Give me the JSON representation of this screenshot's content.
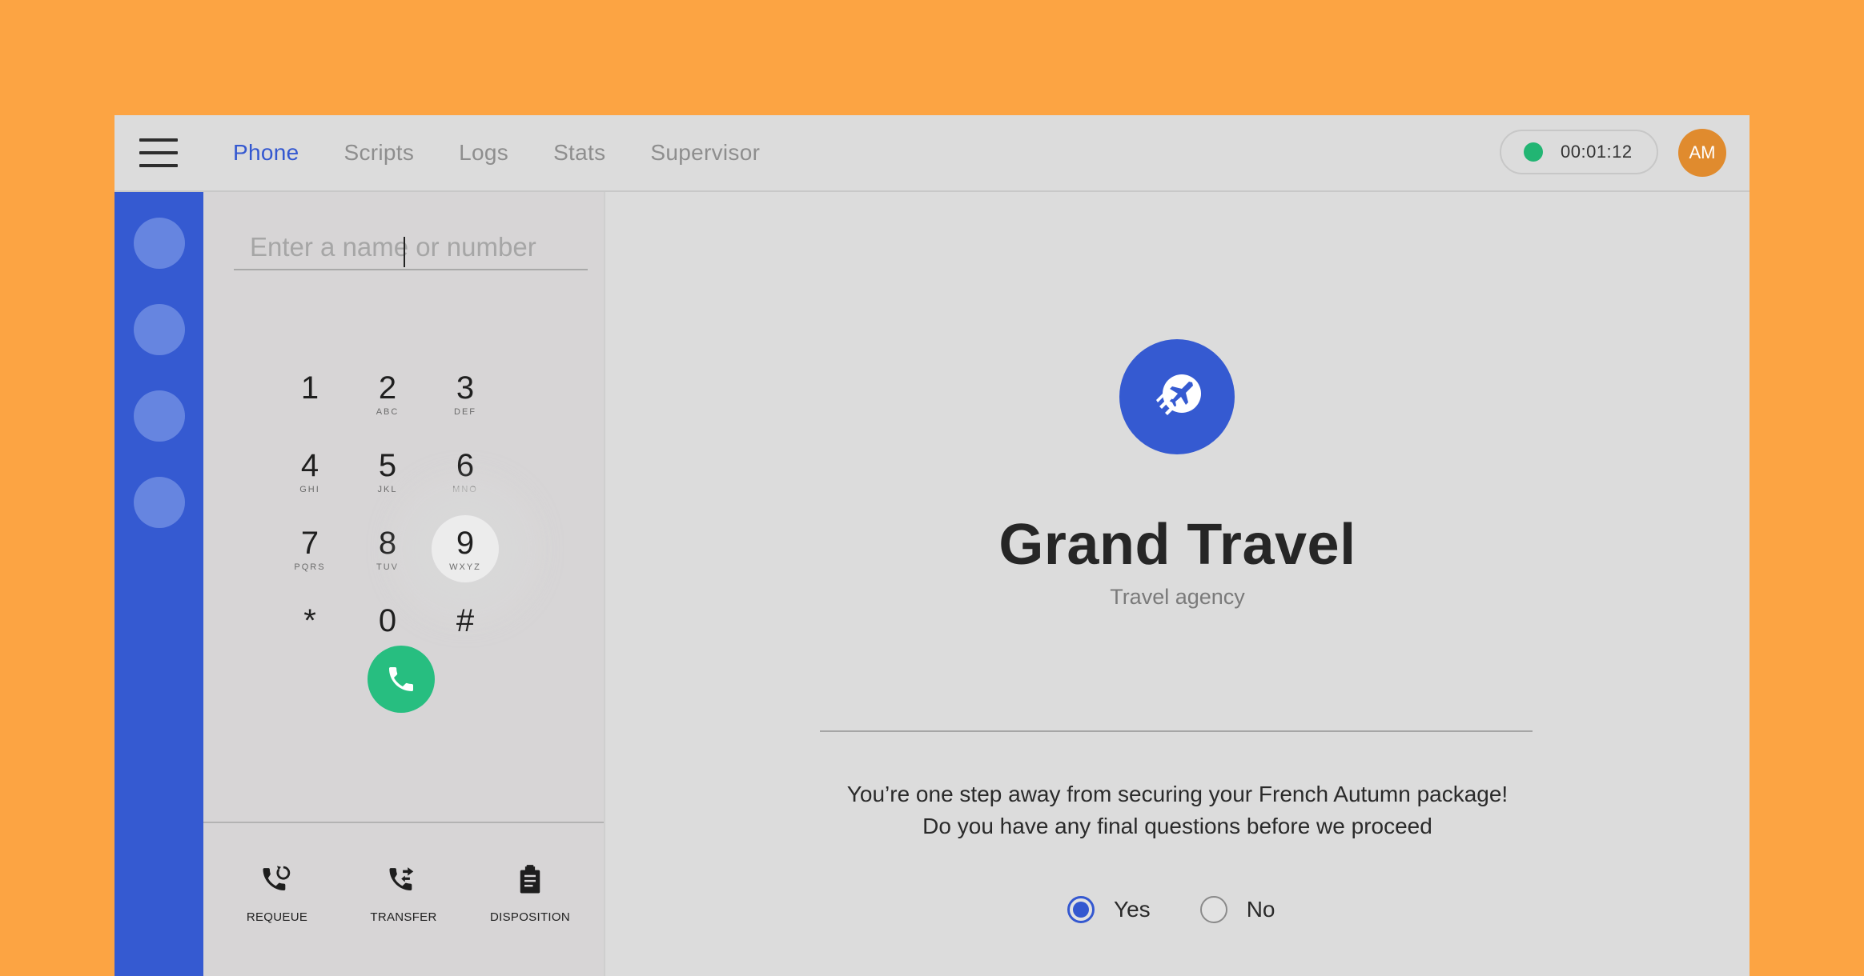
{
  "header": {
    "tabs": [
      {
        "label": "Phone",
        "active": true
      },
      {
        "label": "Scripts",
        "active": false
      },
      {
        "label": "Logs",
        "active": false
      },
      {
        "label": "Stats",
        "active": false
      },
      {
        "label": "Supervisor",
        "active": false
      }
    ],
    "timer": "00:01:12",
    "status_color": "#22B573",
    "avatar_initials": "AM"
  },
  "dialer": {
    "search_placeholder": "Enter a name or number",
    "keys": [
      {
        "num": "1",
        "letters": ""
      },
      {
        "num": "2",
        "letters": "ABC"
      },
      {
        "num": "3",
        "letters": "DEF"
      },
      {
        "num": "4",
        "letters": "GHI"
      },
      {
        "num": "5",
        "letters": "JKL"
      },
      {
        "num": "6",
        "letters": "MNO"
      },
      {
        "num": "7",
        "letters": "PQRS"
      },
      {
        "num": "8",
        "letters": "TUV"
      },
      {
        "num": "9",
        "letters": "WXYZ"
      },
      {
        "num": "*",
        "letters": ""
      },
      {
        "num": "0",
        "letters": ""
      },
      {
        "num": "#",
        "letters": ""
      }
    ],
    "pressed_key": "9",
    "call_icon": "phone-icon",
    "actions": [
      {
        "label": "REQUEUE",
        "icon": "requeue-icon"
      },
      {
        "label": "TRANSFER",
        "icon": "transfer-icon"
      },
      {
        "label": "DISPOSITION",
        "icon": "clipboard-icon"
      }
    ]
  },
  "main": {
    "logo_icon": "airplane-icon",
    "title": "Grand Travel",
    "subtitle": "Travel agency",
    "script_line1": "You’re one step away from securing your French Autumn package!",
    "script_line2": "Do you have any final questions before we proceed",
    "options": [
      {
        "label": "Yes",
        "selected": true
      },
      {
        "label": "No",
        "selected": false
      }
    ]
  },
  "colors": {
    "background": "#FCA443",
    "accent": "#3458D0",
    "sidebar": "#355AD1",
    "call_button": "#27BE80",
    "avatar": "#E08B2E"
  }
}
